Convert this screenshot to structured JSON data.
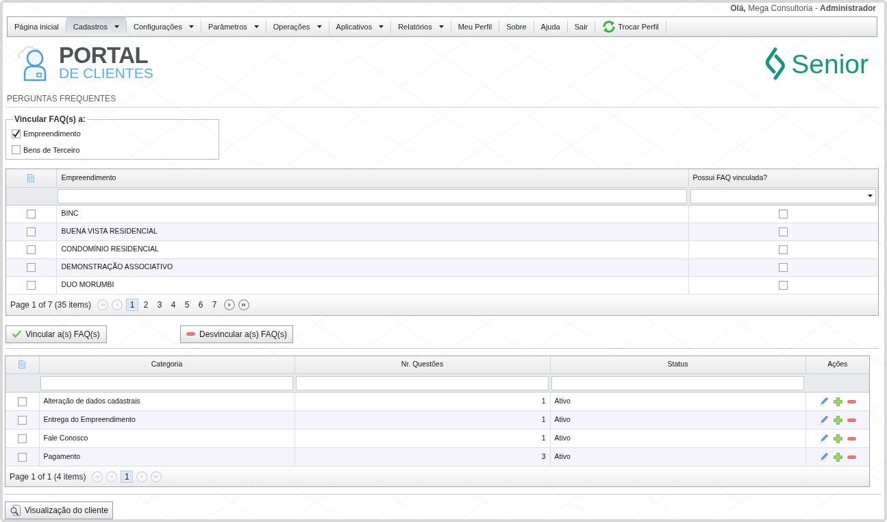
{
  "greeting": "**Olá,** Mega Consultoria - **Administrador**",
  "menu": [
    {
      "label": "Página inicial",
      "kind": "link",
      "selected": false
    },
    {
      "label": "Cadastros",
      "kind": "menu",
      "selected": true
    },
    {
      "label": "Configurações",
      "kind": "menu",
      "selected": false
    },
    {
      "label": "Parâmetros",
      "kind": "menu",
      "selected": false
    },
    {
      "label": "Operações",
      "kind": "menu",
      "selected": false
    },
    {
      "label": "Aplicativos",
      "kind": "menu",
      "selected": false
    },
    {
      "label": "Relatórios",
      "kind": "menu",
      "selected": false
    },
    {
      "label": "Meu Perfil",
      "kind": "link",
      "selected": false
    },
    {
      "label": "Sobre",
      "kind": "link",
      "selected": false
    },
    {
      "label": "Ajuda",
      "kind": "link",
      "selected": false
    },
    {
      "label": "Sair",
      "kind": "link",
      "selected": false
    },
    {
      "label": "Trocar Perfil",
      "kind": "switch",
      "selected": false
    }
  ],
  "logo": {
    "title": "PORTAL",
    "subtitle": "DE CLIENTES"
  },
  "brand": {
    "name": "Senior"
  },
  "page_title": "PERGUNTAS FREQUENTES",
  "link_fieldset": {
    "legend": "Vincular FAQ(s) a:",
    "options": [
      {
        "label": "Empreendimento",
        "checked": true
      },
      {
        "label": "Bens de Terceiro",
        "checked": false
      }
    ]
  },
  "projects_table": {
    "columns": [
      "Empreendimento",
      "Possui FAQ vinculada?"
    ],
    "rows": [
      {
        "name": "BINC",
        "checked": false,
        "has_faq": false
      },
      {
        "name": "BUENA VISTA RESIDENCIAL",
        "checked": false,
        "has_faq": false
      },
      {
        "name": "CONDOMÍNIO RESIDENCIAL",
        "checked": false,
        "has_faq": false
      },
      {
        "name": "DEMONSTRAÇÃO ASSOCIATIVO",
        "checked": false,
        "has_faq": false
      },
      {
        "name": "DUO MORUMBI",
        "checked": false,
        "has_faq": false
      }
    ],
    "pager": {
      "summary": "Page 1 of 7 (35 items)",
      "nav": [
        {
          "kind": "first",
          "disabled": true
        },
        {
          "kind": "prev",
          "disabled": true
        },
        {
          "kind": "next",
          "disabled": false
        },
        {
          "kind": "last",
          "disabled": false
        }
      ],
      "pages": [
        {
          "label": "1",
          "selected": true
        },
        {
          "label": "2",
          "selected": false
        },
        {
          "label": "3",
          "selected": false
        },
        {
          "label": "4",
          "selected": false
        },
        {
          "label": "5",
          "selected": false
        },
        {
          "label": "6",
          "selected": false
        },
        {
          "label": "7",
          "selected": false
        }
      ]
    }
  },
  "actions": [
    {
      "label": "Vincular a(s) FAQ(s)",
      "kind": "link"
    },
    {
      "label": "Desvincular a(s) FAQ(s)",
      "kind": "unlink"
    }
  ],
  "categories_table": {
    "columns": [
      "Categoria",
      "Nr. Questões",
      "Status",
      "Ações"
    ],
    "rows": [
      {
        "category": "Alteração de dados cadastrais",
        "questions": "1",
        "status": "Ativo",
        "checked": false
      },
      {
        "category": "Entrega do Empreendimento",
        "questions": "1",
        "status": "Ativo",
        "checked": false
      },
      {
        "category": "Fale Conosco",
        "questions": "1",
        "status": "Ativo",
        "checked": false
      },
      {
        "category": "Pagamento",
        "questions": "3",
        "status": "Ativo",
        "checked": false
      }
    ],
    "pager": {
      "summary": "Page 1 of 1 (4 items)",
      "nav": [
        {
          "kind": "first",
          "disabled": true
        },
        {
          "kind": "prev",
          "disabled": true
        },
        {
          "kind": "next",
          "disabled": true
        },
        {
          "kind": "last",
          "disabled": true
        }
      ],
      "pages": [
        {
          "label": "1",
          "selected": true
        }
      ]
    }
  },
  "preview_button": {
    "label": "Visualização do cliente"
  }
}
